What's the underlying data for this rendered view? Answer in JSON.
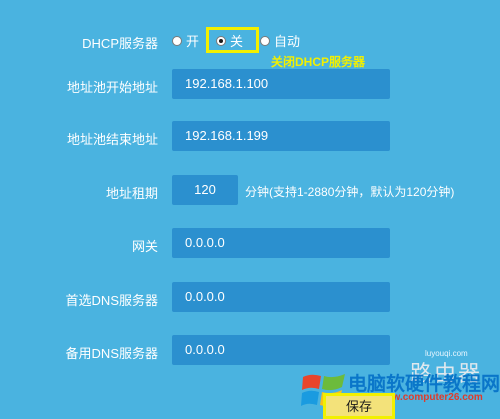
{
  "dhcp": {
    "label": "DHCP服务器",
    "options": [
      {
        "label": "开",
        "checked": false
      },
      {
        "label": "关",
        "checked": true
      },
      {
        "label": "自动",
        "checked": false
      }
    ],
    "annotation": "关闭DHCP服务器"
  },
  "pool_start": {
    "label": "地址池开始地址",
    "value": "192.168.1.100"
  },
  "pool_end": {
    "label": "地址池结束地址",
    "value": "192.168.1.199"
  },
  "lease": {
    "label": "地址租期",
    "value": "120",
    "hint": "分钟(支持1-2880分钟，默认为120分钟)"
  },
  "gateway": {
    "label": "网关",
    "value": "0.0.0.0"
  },
  "primary_dns": {
    "label": "首选DNS服务器",
    "value": "0.0.0.0"
  },
  "secondary_dns": {
    "label": "备用DNS服务器",
    "value": "0.0.0.0"
  },
  "save_label": "保存",
  "watermark": {
    "site_en": "luyouqi.com",
    "site_cn": "路由器",
    "brand": "电脑软硬件教程网",
    "url": "www.computer26.com"
  },
  "colors": {
    "background": "#4ab3e0",
    "field": "#2b90cf",
    "highlight": "#f2f000"
  }
}
